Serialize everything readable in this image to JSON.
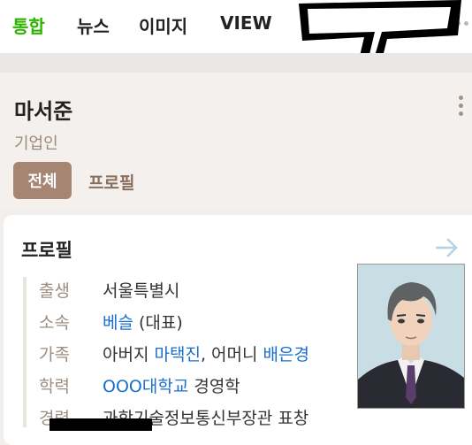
{
  "nav": {
    "tabs": [
      {
        "label": "통합",
        "active": true
      },
      {
        "label": "뉴스"
      },
      {
        "label": "이미지"
      },
      {
        "label": "VIEW"
      }
    ]
  },
  "header": {
    "name": "마서준",
    "subtitle": "기업인",
    "tabs": [
      {
        "label": "전체",
        "active": true
      },
      {
        "label": "프로필"
      }
    ]
  },
  "profile": {
    "title": "프로필",
    "rows": [
      {
        "label": "출생",
        "value": "서울특별시"
      },
      {
        "label": "소속",
        "link1": "베슬",
        "value1": " (대표)"
      },
      {
        "label": "가족",
        "text1": "아버지 ",
        "link1": "마택진",
        "text2": ", 어머니 ",
        "link2": "배은경"
      },
      {
        "label": "학력",
        "link1": "OOO대학교",
        "text1": " 경영학"
      },
      {
        "label": "경력",
        "value": "과학기술정보통신부장관 표창"
      }
    ]
  },
  "colors": {
    "accent_green": "#2db400",
    "pill_bg": "#a68573",
    "link_blue": "#1a6ecd",
    "label_muted": "#9b8d80"
  }
}
